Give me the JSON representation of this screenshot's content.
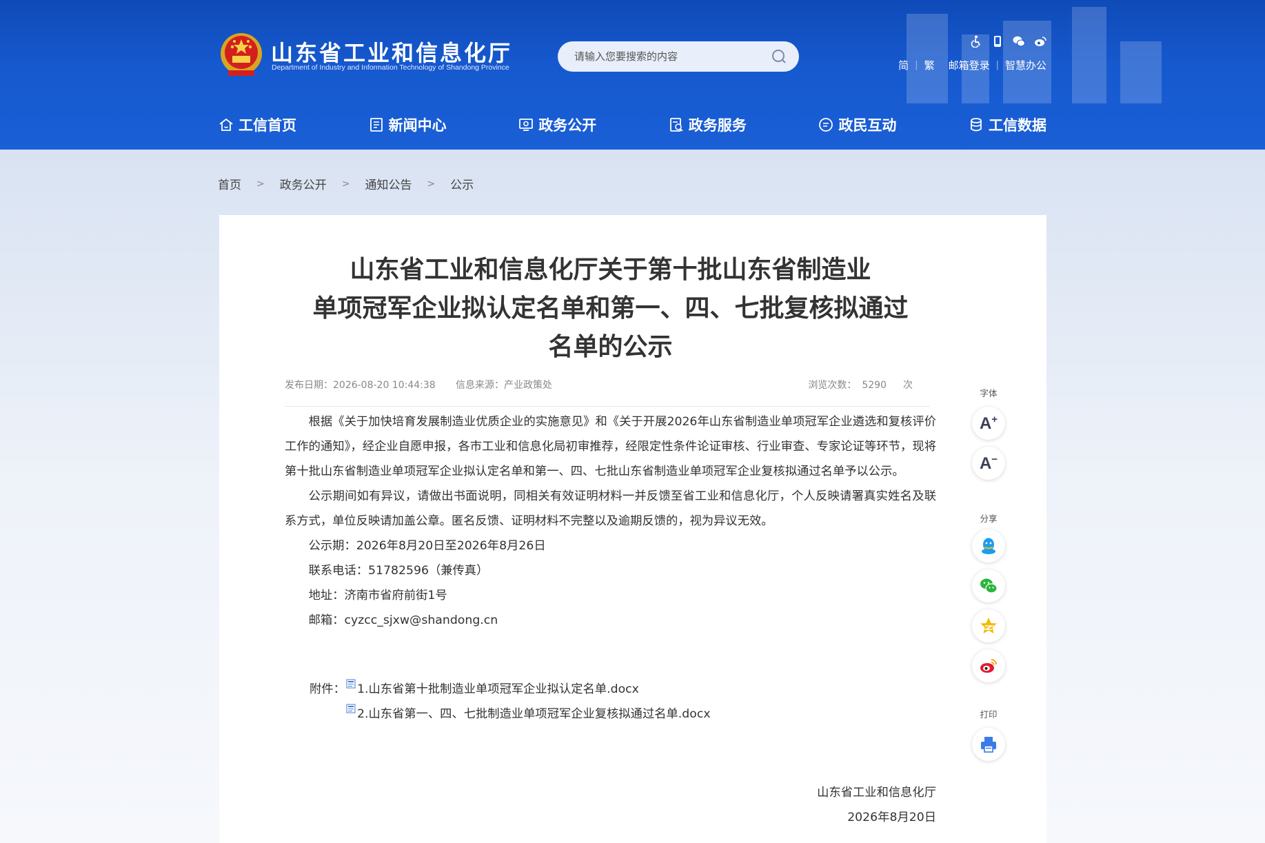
{
  "header": {
    "site_title": "山东省工业和信息化厅",
    "site_subtitle": "Department of Industry and Information Technology of Shandong Province",
    "search_placeholder": "请输入您要搜索的内容",
    "top_icons": [
      "accessibility-icon",
      "mobile-icon",
      "wechat-icon",
      "weibo-icon"
    ],
    "top_links": {
      "simplified": "简",
      "traditional": "繁",
      "mail_login": "邮箱登录",
      "smart_office": "智慧办公"
    },
    "nav": [
      {
        "label": "工信首页",
        "icon": "home-icon"
      },
      {
        "label": "新闻中心",
        "icon": "news-icon"
      },
      {
        "label": "政务公开",
        "icon": "gov-open-icon"
      },
      {
        "label": "政务服务",
        "icon": "gov-service-icon"
      },
      {
        "label": "政民互动",
        "icon": "interaction-icon"
      },
      {
        "label": "工信数据",
        "icon": "database-icon"
      }
    ]
  },
  "breadcrumb": {
    "items": [
      "首页",
      "政务公开",
      "通知公告",
      "公示"
    ],
    "separator": ">"
  },
  "article": {
    "title_lines": [
      "山东省工业和信息化厅关于第十批山东省制造业",
      "单项冠军企业拟认定名单和第一、四、七批复核拟通过",
      "名单的公示"
    ],
    "meta": {
      "date_label": "发布日期：",
      "date": "2026-08-20 10:44:38",
      "source_label": "信息来源：",
      "source": "产业政策处",
      "views_label": "浏览次数：",
      "views": "5290",
      "views_unit": "次"
    },
    "paragraphs": [
      "根据《关于加快培育发展制造业优质企业的实施意见》和《关于开展2026年山东省制造业单项冠军企业遴选和复核评价工作的通知》，经企业自愿申报，各市工业和信息化局初审推荐，经限定性条件论证审核、行业审查、专家论证等环节，现将第十批山东省制造业单项冠军企业拟认定名单和第一、四、七批山东省制造业单项冠军企业复核拟通过名单予以公示。",
      "公示期间如有异议，请做出书面说明，同相关有效证明材料一并反馈至省工业和信息化厅，个人反映请署真实姓名及联系方式，单位反映请加盖公章。匿名反馈、证明材料不完整以及逾期反馈的，视为异议无效。"
    ],
    "info_lines": [
      "公示期：2026年8月20日至2026年8月26日",
      "联系电话：51782596（兼传真）",
      "地址：济南市省府前街1号",
      "邮箱：cyzcc_sjxw@shandong.cn"
    ],
    "attachments_label": "附件：",
    "attachments": [
      "1.山东省第十批制造业单项冠军企业拟认定名单.docx",
      "2.山东省第一、四、七批制造业单项冠军企业复核拟通过名单.docx"
    ],
    "signature_org": "山东省工业和信息化厅",
    "signature_date": "2026年8月20日"
  },
  "tools": {
    "font_label": "字体",
    "font_increase": "A",
    "font_increase_sign": "+",
    "font_decrease": "A",
    "font_decrease_sign": "−",
    "share_label": "分享",
    "share_items": [
      "qq-icon",
      "wechat-icon",
      "qzone-icon",
      "weibo-icon"
    ],
    "print_label": "打印"
  },
  "colors": {
    "header_blue": "#1659cf",
    "qq": "#1e9bf0",
    "wechat": "#2bb63b",
    "qzone": "#f5b900",
    "weibo": "#e6162d",
    "print": "#3a7be8"
  }
}
